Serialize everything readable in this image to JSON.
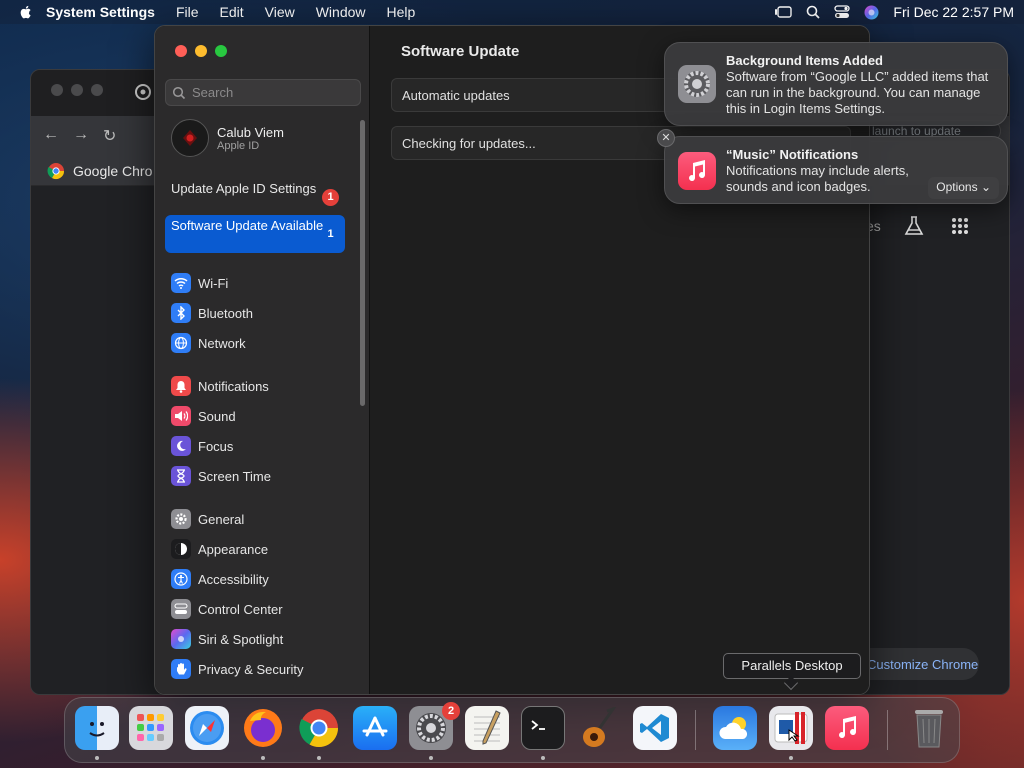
{
  "menubar": {
    "app_name": "System Settings",
    "menus": [
      "File",
      "Edit",
      "View",
      "Window",
      "Help"
    ],
    "datetime": "Fri Dec 22  2:57 PM"
  },
  "chrome": {
    "bookmark_label": "Google Chro",
    "launch_text": "launch to update",
    "partial_text": "es",
    "customize_label": "Customize Chrome"
  },
  "settings": {
    "search_placeholder": "Search",
    "profile": {
      "name": "Calub Viem",
      "subtitle": "Apple ID"
    },
    "promos": [
      {
        "label": "Update Apple ID Settings",
        "badge": "1"
      },
      {
        "label": "Software Update Available",
        "badge": "1"
      }
    ],
    "groups": [
      [
        {
          "label": "Wi-Fi",
          "icon": "wifi-icon",
          "color": "#2f7df6"
        },
        {
          "label": "Bluetooth",
          "icon": "bluetooth-icon",
          "color": "#2f7df6"
        },
        {
          "label": "Network",
          "icon": "globe-icon",
          "color": "#2f7df6"
        }
      ],
      [
        {
          "label": "Notifications",
          "icon": "bell-icon",
          "color": "#ef4a4a"
        },
        {
          "label": "Sound",
          "icon": "speaker-icon",
          "color": "#ef4a6a"
        },
        {
          "label": "Focus",
          "icon": "moon-icon",
          "color": "#6a54d8"
        },
        {
          "label": "Screen Time",
          "icon": "hourglass-icon",
          "color": "#6a54d8"
        }
      ],
      [
        {
          "label": "General",
          "icon": "gear-icon",
          "color": "#8e8e93"
        },
        {
          "label": "Appearance",
          "icon": "appearance-icon",
          "color": "#1c1c1e"
        },
        {
          "label": "Accessibility",
          "icon": "accessibility-icon",
          "color": "#2f7df6"
        },
        {
          "label": "Control Center",
          "icon": "control-center-icon",
          "color": "#8e8e93"
        },
        {
          "label": "Siri & Spotlight",
          "icon": "siri-icon",
          "color": "#9b4ad8"
        },
        {
          "label": "Privacy & Security",
          "icon": "hand-icon",
          "color": "#2f7df6"
        }
      ]
    ],
    "page_title": "Software Update",
    "rows": [
      "Automatic updates",
      "Checking for updates..."
    ]
  },
  "notifications": [
    {
      "title": "Background Items Added",
      "body": "Software from “Google LLC” added items that can run in the background. You can manage this in Login Items Settings."
    },
    {
      "title": "“Music” Notifications",
      "body": "Notifications may include alerts, sounds and icon badges.",
      "options_label": "Options"
    }
  ],
  "tooltip": "Parallels Desktop",
  "dock": {
    "apps": [
      "finder",
      "launchpad",
      "safari",
      "firefox",
      "chrome",
      "app-store",
      "system-settings",
      "textedit",
      "terminal",
      "garageband",
      "vscode",
      "weather",
      "parallels-desktop",
      "music",
      "trash"
    ],
    "settings_badge": "2"
  }
}
